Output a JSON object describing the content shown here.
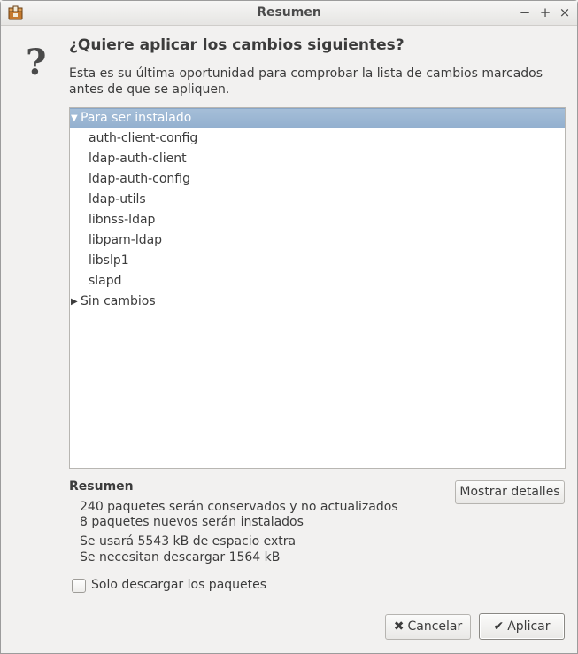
{
  "window": {
    "title": "Resumen",
    "controls": {
      "minimize": "−",
      "maximize": "+",
      "close": "×"
    }
  },
  "dialog": {
    "icon": "?",
    "heading": "¿Quiere aplicar los cambios siguientes?",
    "description": "Esta es su última oportunidad para comprobar la lista de cambios marcados antes de que se apliquen."
  },
  "changes": {
    "groups": [
      {
        "label": "Para ser instalado",
        "expanded": true,
        "selected": true,
        "items": [
          "auth-client-config",
          "ldap-auth-client",
          "ldap-auth-config",
          "ldap-utils",
          "libnss-ldap",
          "libpam-ldap",
          "libslp1",
          "slapd"
        ]
      },
      {
        "label": "Sin cambios",
        "expanded": false,
        "selected": false,
        "items": []
      }
    ]
  },
  "summary": {
    "title": "Resumen",
    "lines": [
      "240 paquetes serán conservados y no actualizados",
      "8 paquetes nuevos serán instalados",
      "Se usará 5543 kB de espacio extra",
      "Se necesitan descargar 1564 kB"
    ],
    "details_button": "Mostrar detalles"
  },
  "options": {
    "download_only_label": "Solo descargar los paquetes",
    "download_only_checked": false
  },
  "buttons": {
    "cancel_label": "Cancelar",
    "apply_label": "Aplicar"
  },
  "colors": {
    "selection": "#9ab5d3",
    "background": "#f2f1f0"
  }
}
